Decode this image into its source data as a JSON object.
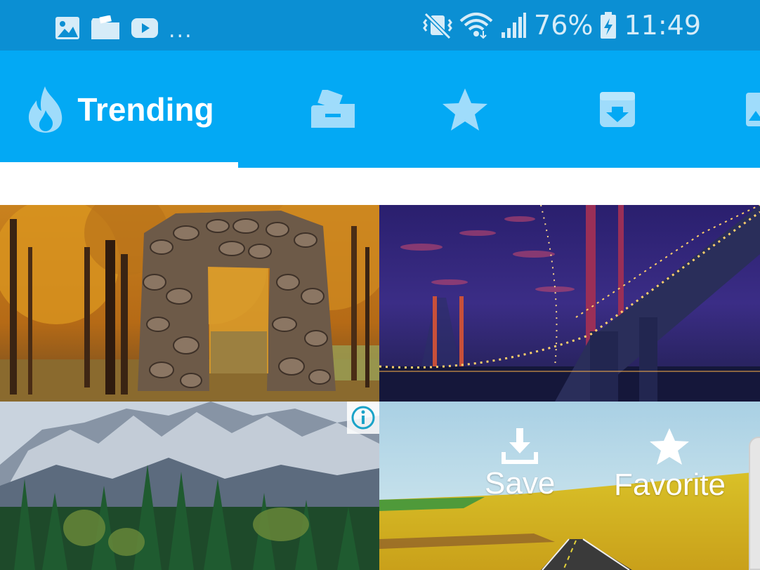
{
  "status_bar": {
    "battery": "76%",
    "time": "11:49",
    "more": "...",
    "left_icons": [
      "gallery-icon",
      "folder-icon",
      "youtube-icon"
    ],
    "right_icons": [
      "mute-vibrate-icon",
      "wifi-icon",
      "signal-icon",
      "battery-charging-icon"
    ]
  },
  "tabs": [
    {
      "label": "Trending",
      "icon": "flame-icon",
      "selected": true
    },
    {
      "label": "",
      "icon": "category-folder-icon",
      "selected": false
    },
    {
      "label": "",
      "icon": "star-icon",
      "selected": false
    },
    {
      "label": "",
      "icon": "download-box-icon",
      "selected": false
    },
    {
      "label": "",
      "icon": "image-icon",
      "selected": false
    }
  ],
  "overlay": {
    "save_label": "Save",
    "favorite_label": "Favorite"
  },
  "tiles": [
    {
      "subject": "stone-ruin-autumn-forest"
    },
    {
      "subject": "bridge-at-night"
    },
    {
      "subject": "mountains-pine-forest",
      "ad_info": true
    },
    {
      "subject": "road-through-golden-fields"
    }
  ],
  "colors": {
    "status_bar": "#0b8fd3",
    "app_bar": "#03a9f4",
    "tab_icon_inactive": "#9fdcfb",
    "indicator": "#ffffff"
  }
}
